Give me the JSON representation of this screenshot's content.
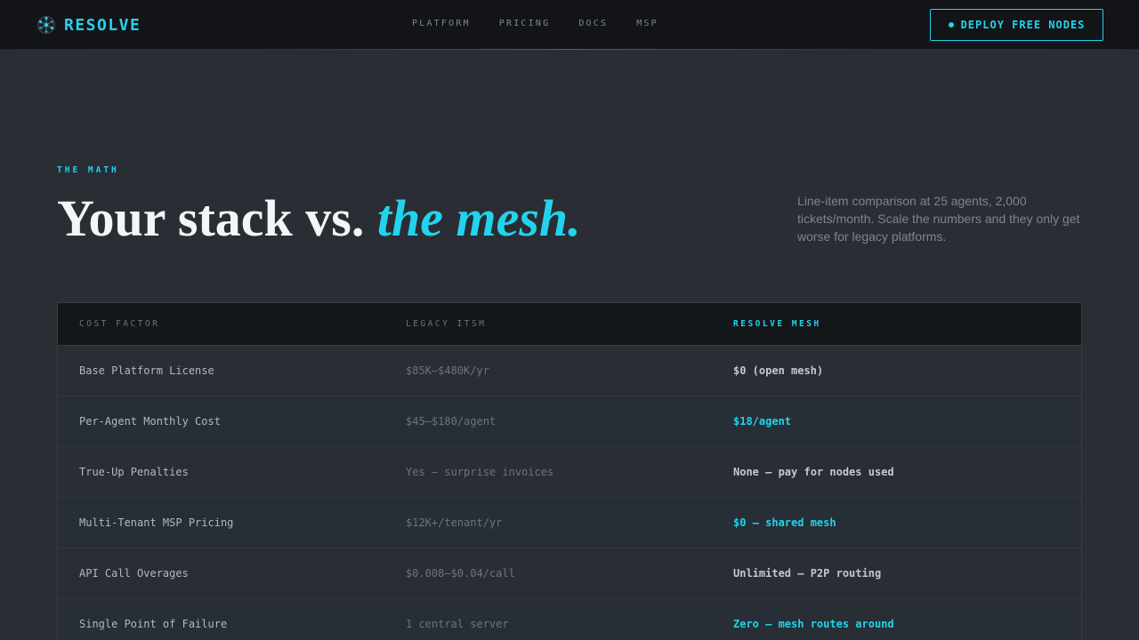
{
  "nav": {
    "brand": "RESOLVE",
    "links": [
      "PLATFORM",
      "PRICING",
      "DOCS",
      "MSP"
    ],
    "cta_label": "DEPLOY FREE NODES"
  },
  "hero": {
    "eyebrow": "THE MATH",
    "headline_plain": "Your stack vs. ",
    "headline_accent": "the mesh.",
    "lede": "Line-item comparison at 25 agents, 2,000 tickets/month. Scale the numbers and they only get worse for legacy platforms."
  },
  "table": {
    "headers": [
      "COST FACTOR",
      "LEGACY ITSM",
      "RESOLVE MESH"
    ],
    "rows": [
      {
        "factor": "Base Platform License",
        "legacy": "$85K–$480K/yr",
        "mesh": "$0 (open mesh)",
        "highlight": false
      },
      {
        "factor": "Per-Agent Monthly Cost",
        "legacy": "$45–$180/agent",
        "mesh": "$18/agent",
        "highlight": true
      },
      {
        "factor": "True-Up Penalties",
        "legacy": "Yes — surprise invoices",
        "mesh": "None — pay for nodes used",
        "highlight": false
      },
      {
        "factor": "Multi-Tenant MSP Pricing",
        "legacy": "$12K+/tenant/yr",
        "mesh": "$0 — shared mesh",
        "highlight": true
      },
      {
        "factor": "API Call Overages",
        "legacy": "$0.008–$0.04/call",
        "mesh": "Unlimited — P2P routing",
        "highlight": false
      },
      {
        "factor": "Single Point of Failure",
        "legacy": "1 central server",
        "mesh": "Zero — mesh routes around",
        "highlight": true
      }
    ]
  },
  "colors": {
    "accent": "#22d3ee",
    "background": "#2a2d33",
    "nav_background": "#121417"
  },
  "icons": {
    "brand": "mesh-node-logo-icon",
    "cta": "status-dot-icon"
  }
}
